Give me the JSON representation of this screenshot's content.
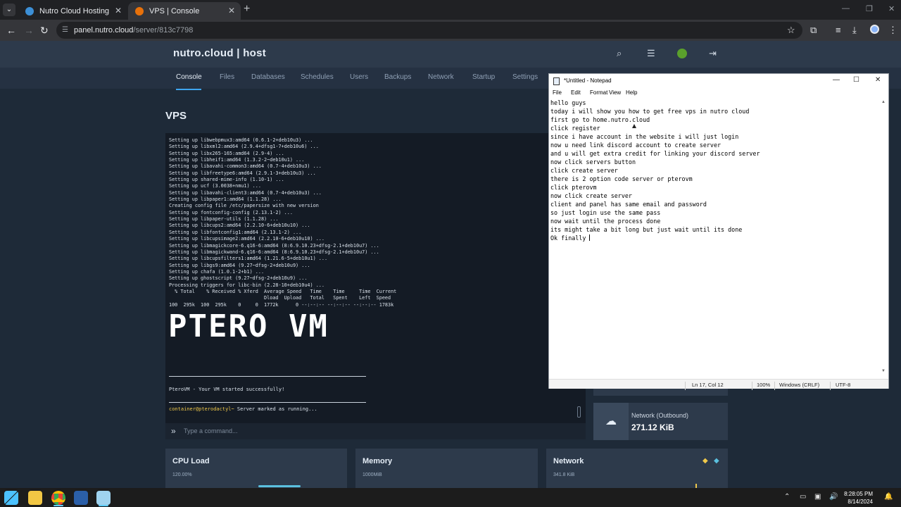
{
  "browser": {
    "tabs": [
      {
        "title": "Nutro Cloud Hosting",
        "active": false
      },
      {
        "title": "VPS | Console",
        "active": true
      }
    ],
    "new_tab": "+",
    "close_glyph": "✕",
    "url_host": "panel.nutro.cloud",
    "url_path": "/server/813c7798"
  },
  "panel": {
    "brand": "nutro.cloud | host",
    "nav": [
      "Console",
      "Files",
      "Databases",
      "Schedules",
      "Users",
      "Backups",
      "Network",
      "Startup",
      "Settings"
    ],
    "active_nav": "Console",
    "page_title": "VPS",
    "icons": [
      "search-icon",
      "layers-icon",
      "status-dot-icon",
      "logout-icon"
    ]
  },
  "console": {
    "lines": [
      "Setting up libwebpmux3:amd64 (0.6.1-2+deb10u3) ...",
      "Setting up libxml2:amd64 (2.9.4+dfsg1-7+deb10u6) ...",
      "Setting up libx265-165:amd64 (2.9-4) ...",
      "Setting up libheif1:amd64 (1.3.2-2~deb10u1) ...",
      "Setting up libavahi-common3:amd64 (0.7-4+deb10u3) ...",
      "Setting up libfreetype6:amd64 (2.9.1-3+deb10u3) ...",
      "Setting up shared-mime-info (1.10-1) ...",
      "Setting up ucf (3.0038+nmu1) ...",
      "Setting up libavahi-client3:amd64 (0.7-4+deb10u3) ...",
      "Setting up libpaper1:amd64 (1.1.28) ...",
      "Creating config file /etc/papersize with new version",
      "Setting up fontconfig-config (2.13.1-2) ...",
      "Setting up libpaper-utils (1.1.28) ...",
      "Setting up libcups2:amd64 (2.2.10-6+deb10u10) ...",
      "Setting up libfontconfig1:amd64 (2.13.1-2) ...",
      "Setting up libcupsimage2:amd64 (2.2.10-6+deb10u10) ...",
      "Setting up libmagickcore-6.q16-6:amd64 (8:6.9.10.23+dfsg-2.1+deb10u7) ...",
      "Setting up libmagickwand-6.q16-6:amd64 (8:6.9.10.23+dfsg-2.1+deb10u7) ...",
      "Setting up libcupsfilters1:amd64 (1.21.6-5+deb10u1) ...",
      "Setting up libgs9:amd64 (9.27~dfsg-2+deb10u9) ...",
      "Setting up chafa (1.0.1-2+b1) ...",
      "Setting up ghostscript (9.27~dfsg-2+deb10u9) ...",
      "Processing triggers for libc-bin (2.28-10+deb10u4) ...",
      "  % Total    % Received % Xferd  Average Speed   Time    Time     Time  Current",
      "                                 Dload  Upload   Total   Spent    Left  Speed",
      "100  295k  100  295k    0     0  1772k      0 --:--:-- --:--:-- --:--:-- 1783k"
    ],
    "logo": "PTERO VM",
    "started_msg": "PteroVM - Your VM started successfully!",
    "prompt_user": "container@pterodactyl~",
    "prompt_msg": " Server marked as running...",
    "command_placeholder": "Type a command..."
  },
  "stats": {
    "network_outbound_label": "Network (Outbound)",
    "network_outbound_value": "271.12 KiB"
  },
  "graphs": [
    {
      "title": "CPU Load",
      "sub": "120.00%"
    },
    {
      "title": "Memory",
      "sub": "1000MiB"
    },
    {
      "title": "Network",
      "sub": "341.8 KiB"
    }
  ],
  "notepad": {
    "title": "*Untitled - Notepad",
    "menu": [
      "File",
      "Edit",
      "Format",
      "View",
      "Help"
    ],
    "lines": [
      "hello guys",
      "today i will show you how to get free vps in nutro cloud",
      "first go to home.nutro.cloud",
      "click register",
      "since i have account in the website i will just login",
      "now u need link discord account to create server",
      "and u will get extra credit for linking your discord server",
      "now click servers button",
      "click create server",
      "there is 2 option code server or pterovm",
      "click pterovm",
      "now click create server",
      "client and panel has same email and password",
      "so just login use the same pass",
      "now wait until the process done",
      "its might take a bit long but just wait until its done",
      "Ok finally "
    ],
    "status_position": "Ln 17, Col 12",
    "status_zoom": "100%",
    "status_eol": "Windows (CRLF)",
    "status_encoding": "UTF-8"
  },
  "taskbar": {
    "time": "8:28:05 PM",
    "date": "8/14/2024"
  }
}
